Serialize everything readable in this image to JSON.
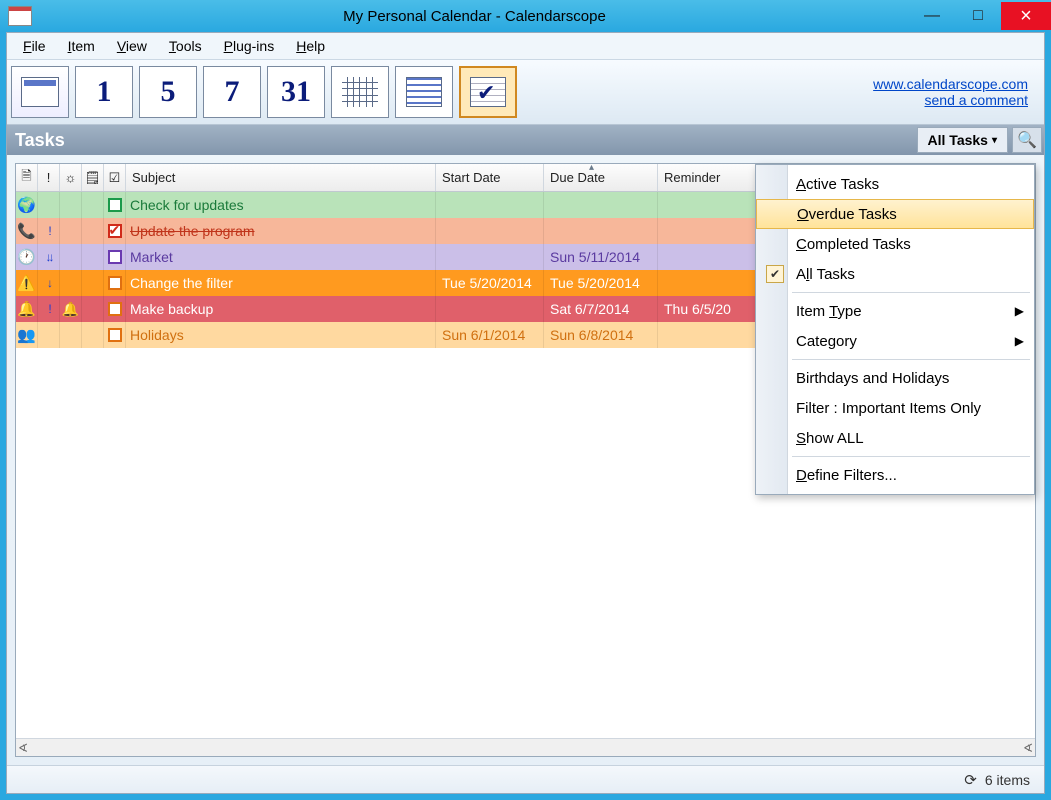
{
  "window": {
    "title": "My Personal Calendar - Calendarscope"
  },
  "menu": {
    "file": "File",
    "item": "Item",
    "view": "View",
    "tools": "Tools",
    "plugins": "Plug-ins",
    "help": "Help"
  },
  "toolbar": {
    "day1": "1",
    "day5": "5",
    "day7": "7",
    "day31": "31",
    "link1": "www.calendarscope.com",
    "link2": "send a comment"
  },
  "tasksHeader": {
    "title": "Tasks",
    "filterLabel": "All Tasks"
  },
  "columns": {
    "subject": "Subject",
    "start": "Start Date",
    "due": "Due Date",
    "reminder": "Reminder"
  },
  "rows": [
    {
      "icon": "🌍",
      "priority": "",
      "alarm": "",
      "subject": "Check for updates",
      "start": "",
      "due": "",
      "rem": "",
      "chk": "green"
    },
    {
      "icon": "📞",
      "priority": "!",
      "alarm": "",
      "subject": "Update the program",
      "start": "",
      "due": "",
      "rem": "",
      "chk": "red",
      "checked": true
    },
    {
      "icon": "🕐",
      "priority": "↓↓",
      "alarm": "",
      "subject": "Market",
      "start": "",
      "due": "Sun 5/11/2014",
      "rem": "",
      "chk": "purple"
    },
    {
      "icon": "⚠️",
      "priority": "↓",
      "alarm": "",
      "subject": "Change the filter",
      "start": "Tue 5/20/2014",
      "due": "Tue 5/20/2014",
      "rem": "",
      "chk": "orange"
    },
    {
      "icon": "🔔",
      "priority": "!",
      "alarm": "🔔",
      "subject": "Make backup",
      "start": "",
      "due": "Sat 6/7/2014",
      "rem": "Thu 6/5/20",
      "chk": "orange"
    },
    {
      "icon": "👥",
      "priority": "",
      "alarm": "",
      "subject": "Holidays",
      "start": "Sun 6/1/2014",
      "due": "Sun 6/8/2014",
      "rem": "",
      "chk": "orange"
    }
  ],
  "dropdown": {
    "active": "Active Tasks",
    "overdue": "Overdue Tasks",
    "completed": "Completed Tasks",
    "all": "All Tasks",
    "itemtype": "Item Type",
    "category": "Category",
    "birthdays": "Birthdays and Holidays",
    "filter": "Filter : Important Items Only",
    "showall": "Show ALL",
    "define": "Define Filters..."
  },
  "status": {
    "count": "6 items"
  }
}
